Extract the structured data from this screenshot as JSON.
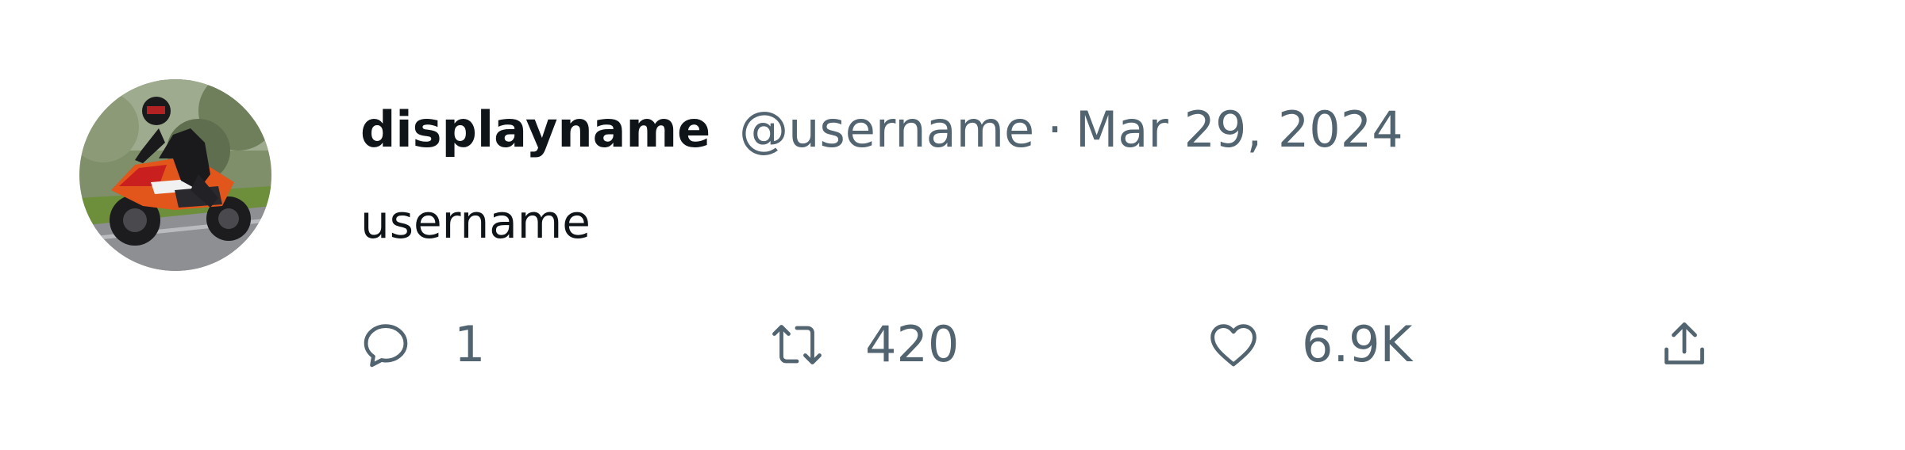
{
  "tweet": {
    "display_name": "displayname",
    "handle": "@username",
    "separator": "·",
    "date": "Mar 29, 2024",
    "text": "username",
    "avatar_icon": "motorcycle-rider-avatar"
  },
  "actions": {
    "reply": {
      "icon": "reply-icon",
      "count": "1"
    },
    "retweet": {
      "icon": "retweet-icon",
      "count": "420"
    },
    "like": {
      "icon": "heart-icon",
      "count": "6.9K"
    },
    "share": {
      "icon": "share-icon"
    }
  },
  "colors": {
    "primary_text": "#0f1419",
    "secondary_text": "#536471"
  }
}
